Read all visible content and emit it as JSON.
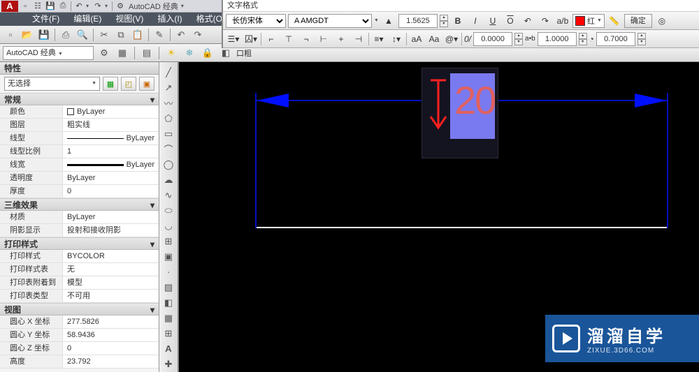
{
  "app": {
    "logo": "A",
    "title": "AutoCAD 经典"
  },
  "menu": [
    "文件(F)",
    "编辑(E)",
    "视图(V)",
    "插入(I)",
    "格式(O)"
  ],
  "text_format": {
    "title": "文字格式",
    "font1": "长仿宋体",
    "font2": "A AMGDT",
    "height": "1.5625",
    "bold": "B",
    "italic": "I",
    "under": "U",
    "over": "O",
    "color_name": "红",
    "confirm": "确定",
    "tracking": "0.0000",
    "width_factor": "1.0000",
    "obliq": "0.7000"
  },
  "workspace": {
    "name": "AutoCAD 经典"
  },
  "properties": {
    "title": "特性",
    "selection": "无选择",
    "sections": {
      "general": {
        "title": "常规",
        "rows": [
          {
            "k": "颜色",
            "v": "ByLayer",
            "swatch": true
          },
          {
            "k": "图层",
            "v": "粗实线"
          },
          {
            "k": "线型",
            "v": "ByLayer",
            "line": true
          },
          {
            "k": "线型比例",
            "v": "1"
          },
          {
            "k": "线宽",
            "v": "ByLayer",
            "thick": true
          },
          {
            "k": "透明度",
            "v": "ByLayer"
          },
          {
            "k": "厚度",
            "v": "0"
          }
        ]
      },
      "threeD": {
        "title": "三维效果",
        "rows": [
          {
            "k": "材质",
            "v": "ByLayer"
          },
          {
            "k": "阴影显示",
            "v": "投射和接收阴影"
          }
        ]
      },
      "plot": {
        "title": "打印样式",
        "rows": [
          {
            "k": "打印样式",
            "v": "BYCOLOR"
          },
          {
            "k": "打印样式表",
            "v": "无"
          },
          {
            "k": "打印表附着到",
            "v": "模型"
          },
          {
            "k": "打印表类型",
            "v": "不可用"
          }
        ]
      },
      "view": {
        "title": "视图",
        "rows": [
          {
            "k": "圆心 X 坐标",
            "v": "277.5826"
          },
          {
            "k": "圆心 Y 坐标",
            "v": "58.9436"
          },
          {
            "k": "圆心 Z 坐标",
            "v": "0"
          },
          {
            "k": "高度",
            "v": "23.792"
          }
        ]
      }
    }
  },
  "canvas": {
    "dim_text": "20"
  },
  "watermark": {
    "main": "溜溜自学",
    "sub": "ZIXUE.3D66.COM"
  }
}
